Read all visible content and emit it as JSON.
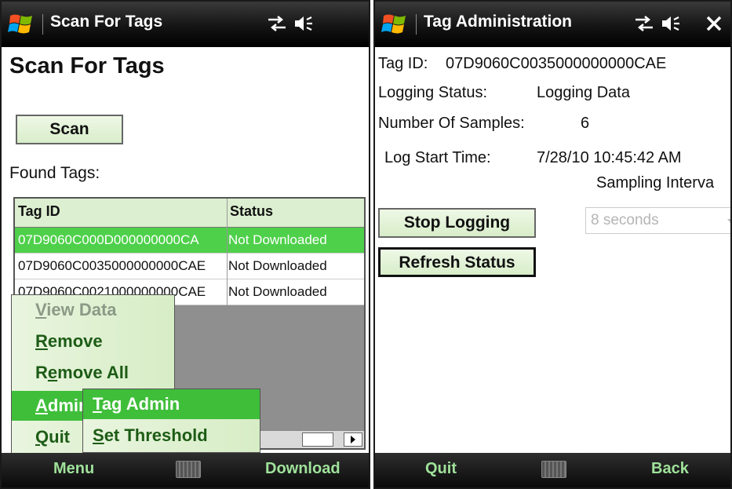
{
  "colors": {
    "accent_green": "#4ed04a",
    "softkey_text": "#9fe29a",
    "titlebar": "#141414"
  },
  "left": {
    "titlebar": {
      "title": "Scan For Tags",
      "icons": [
        "windows-start-icon",
        "connectivity-icon",
        "speaker-icon"
      ]
    },
    "page_title": "Scan For Tags",
    "scan_button": "Scan",
    "found_tags_label": "Found Tags:",
    "table": {
      "headers": [
        "Tag ID",
        "Status"
      ],
      "rows": [
        {
          "tag_id": "07D9060C000D000000000CA",
          "status": "Not Downloaded",
          "selected": true
        },
        {
          "tag_id": "07D9060C0035000000000CAE",
          "status": "Not Downloaded",
          "selected": false
        },
        {
          "tag_id": "07D9060C0021000000000CAE",
          "status": "Not Downloaded",
          "selected": false
        }
      ]
    },
    "menu": {
      "items": [
        {
          "pre": "",
          "ul": "V",
          "post": "iew Data",
          "state": "disabled"
        },
        {
          "pre": "",
          "ul": "R",
          "post": "emove",
          "state": "normal"
        },
        {
          "pre": "R",
          "ul": "e",
          "post": "move All",
          "state": "normal"
        },
        {
          "pre": "",
          "ul": "A",
          "post": "dmin",
          "state": "highlighted"
        },
        {
          "pre": "",
          "ul": "Q",
          "post": "uit",
          "state": "normal"
        }
      ]
    },
    "submenu": {
      "items": [
        {
          "ul": "T",
          "post": "ag Admin",
          "state": "highlighted"
        },
        {
          "ul": "S",
          "post": "et Threshold",
          "state": "normal"
        }
      ]
    },
    "softkeys": {
      "left": "Menu",
      "right": "Download"
    }
  },
  "right": {
    "titlebar": {
      "title": "Tag Administration",
      "icons": [
        "windows-start-icon",
        "connectivity-icon",
        "speaker-icon",
        "close-icon"
      ]
    },
    "tag_id_label": "Tag ID:",
    "tag_id_value": "07D9060C0035000000000CAE",
    "logging_status_label": "Logging Status:",
    "logging_status_value": "Logging Data",
    "samples_label": "Number Of Samples:",
    "samples_value": "6",
    "log_start_label": "Log Start Time:",
    "log_start_value": "7/28/10 10:45:42 AM",
    "sampling_interval_label": "Sampling Interva",
    "stop_logging_button": "Stop Logging",
    "interval_dropdown": "8 seconds",
    "refresh_button": "Refresh Status",
    "softkeys": {
      "left": "Quit",
      "right": "Back"
    }
  }
}
